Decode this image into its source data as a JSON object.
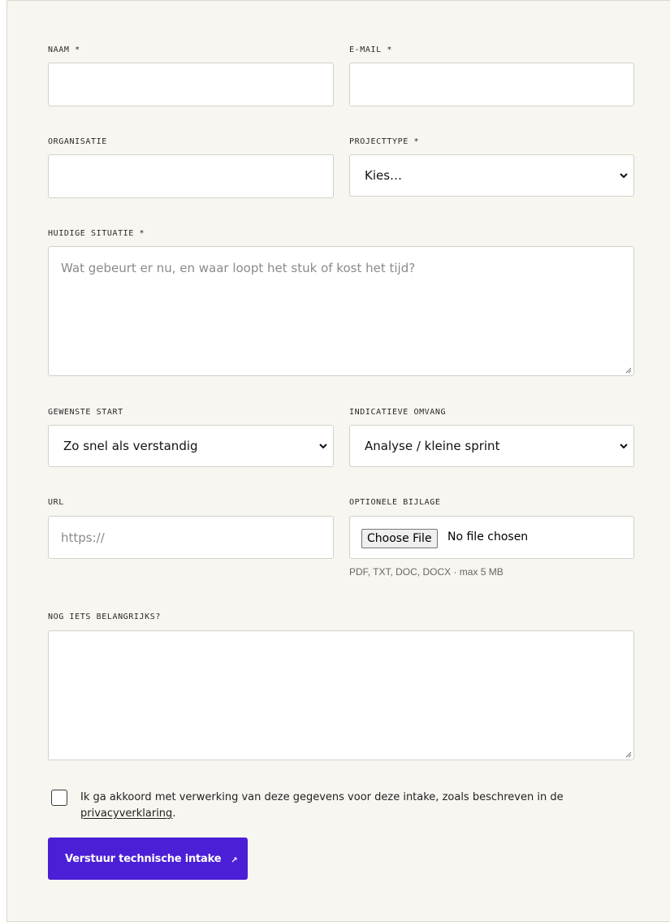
{
  "form": {
    "name_label": "NAAM *",
    "email_label": "E-MAIL *",
    "organisation_label": "ORGANISATIE",
    "projecttype_label": "PROJECTTYPE *",
    "projecttype_value": "Kies…",
    "situation_label": "HUIDIGE SITUATIE *",
    "situation_placeholder": "Wat gebeurt er nu, en waar loopt het stuk of kost het tijd?",
    "start_label": "GEWENSTE START",
    "start_value": "Zo snel als verstandig",
    "scope_label": "INDICATIEVE OMVANG",
    "scope_value": "Analyse / kleine sprint",
    "url_label": "URL",
    "url_placeholder": "https://",
    "attachment_label": "OPTIONELE BIJLAGE",
    "file_button": "Choose File",
    "file_status": "No file chosen",
    "attachment_hint": "PDF, TXT, DOC, DOCX · max 5 MB",
    "notes_label": "NOG IETS BELANGRIJKS?",
    "consent_text": "Ik ga akkoord met verwerking van deze gegevens voor deze intake, zoals beschreven in de",
    "consent_link": "privacyverklaring",
    "consent_end": ".",
    "submit_label": "Verstuur technische intake",
    "submit_arrow": "↗"
  },
  "colors": {
    "accent": "#4a1fd6",
    "background": "#f8f6f1",
    "field_border": "#d3d0c8"
  },
  "icons": {
    "select": "chevron-down-icon",
    "resize": "resize-grip-icon",
    "submit": "arrow-up-right-icon"
  }
}
